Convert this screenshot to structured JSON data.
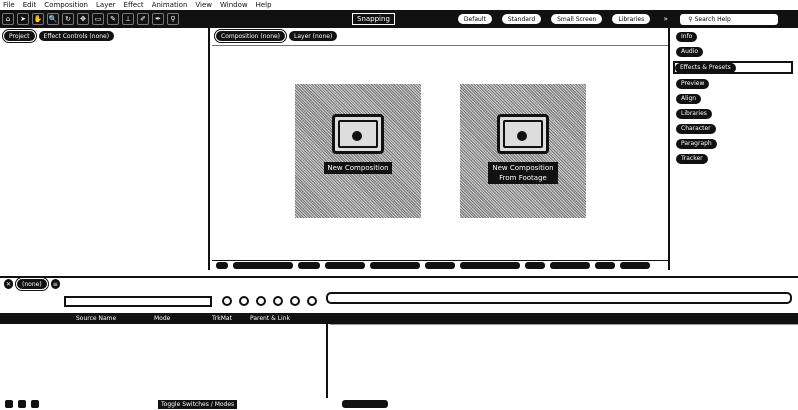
{
  "menubar": [
    "File",
    "Edit",
    "Composition",
    "Layer",
    "Effect",
    "Animation",
    "View",
    "Window",
    "Help"
  ],
  "toolbar": {
    "tools": [
      "⌂",
      "➤",
      "✋",
      "🔍",
      "↻",
      "✥",
      "▭",
      "✎",
      "⊥",
      "✐",
      "✒",
      "⚲"
    ],
    "snapping": "Snapping",
    "workspaces": [
      "Default",
      "Standard",
      "Small Screen",
      "Libraries"
    ],
    "search_placeholder": "Search Help"
  },
  "left_panel": {
    "tabs": [
      "Project",
      "Effect Controls (none)"
    ]
  },
  "center_panel": {
    "tabs": [
      "Composition (none)",
      "Layer (none)"
    ],
    "cards": [
      {
        "label": "New Composition"
      },
      {
        "label": "New Composition From Footage"
      }
    ]
  },
  "right_panel": {
    "items": [
      "Info",
      "Audio",
      "Effects & Presets",
      "Preview",
      "Align",
      "Libraries",
      "Character",
      "Paragraph",
      "Tracker"
    ],
    "active_item": "Effects & Presets"
  },
  "timeline": {
    "tab": "(none)",
    "columns": [
      "Source Name",
      "Mode",
      "TrkMat",
      "Parent & Link"
    ],
    "footer_label": "Toggle Switches / Modes"
  }
}
